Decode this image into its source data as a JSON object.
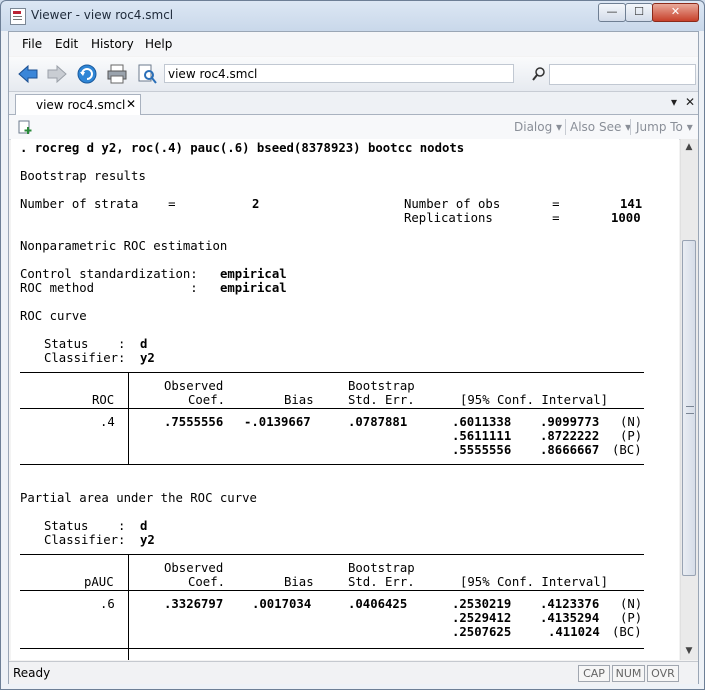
{
  "window": {
    "title": "Viewer - view roc4.smcl",
    "min": "—",
    "max": "☐",
    "close": "✕"
  },
  "menu": [
    "File",
    "Edit",
    "History",
    "Help"
  ],
  "toolbar": {
    "address": "view roc4.smcl",
    "find_value": ""
  },
  "tab": {
    "label": "view roc4.smcl",
    "close": "✕"
  },
  "tab_controls": {
    "dropdown": "▾",
    "close": "✕"
  },
  "viewer_tools": {
    "dialog": "Dialog ▾",
    "also_see": "Also See ▾",
    "jump_to": "Jump To ▾"
  },
  "output": {
    "command": ". rocreg d y2, roc(.4) pauc(.6) bseed(8378923) bootcc nodots",
    "bootstrap_title": "Bootstrap results",
    "strata_label": "Number of strata    =",
    "strata_value": "2",
    "obs_label": "Number of obs       =",
    "obs_value": "141",
    "reps_label": "Replications        =",
    "reps_value": "1000",
    "np_title": "Nonparametric ROC estimation",
    "control_label": "Control standardization:",
    "control_value": "empirical",
    "method_label": "ROC method             :",
    "method_value": "empirical",
    "roc_curve_title": "ROC curve",
    "status_label": "Status    :",
    "status_value": "d",
    "classifier_label": "Classifier:",
    "classifier_value": "y2",
    "hdr_observed": "Observed",
    "hdr_coef": "Coef.",
    "hdr_bias": "Bias",
    "hdr_bootstrap": "Bootstrap",
    "hdr_stderr": "Std. Err.",
    "hdr_ci": "[95% Conf. Interval]",
    "roc_col": "ROC",
    "roc_row": {
      "param": ".4",
      "coef": ".7555556",
      "bias": "-.0139667",
      "se": ".0787881",
      "ci": [
        {
          "lo": ".6011338",
          "hi": ".9099773",
          "type": "(N)"
        },
        {
          "lo": ".5611111",
          "hi": ".8722222",
          "type": "(P)"
        },
        {
          "lo": ".5555556",
          "hi": ".8666667",
          "type": "(BC)"
        }
      ]
    },
    "pauc_title": "Partial area under the ROC curve",
    "pauc_col": "pAUC",
    "pauc_row": {
      "param": ".6",
      "coef": ".3326797",
      "bias": ".0017034",
      "se": ".0406425",
      "ci": [
        {
          "lo": ".2530219",
          "hi": ".4123376",
          "type": "(N)"
        },
        {
          "lo": ".2529412",
          "hi": ".4135294",
          "type": "(P)"
        },
        {
          "lo": ".2507625",
          "hi": ".411024",
          "type": "(BC)"
        }
      ]
    }
  },
  "status": {
    "text": "Ready",
    "cap": "CAP",
    "num": "NUM",
    "ovr": "OVR"
  },
  "colors": {
    "accent": "#1f5fbf",
    "frame": "#cfdcec"
  }
}
